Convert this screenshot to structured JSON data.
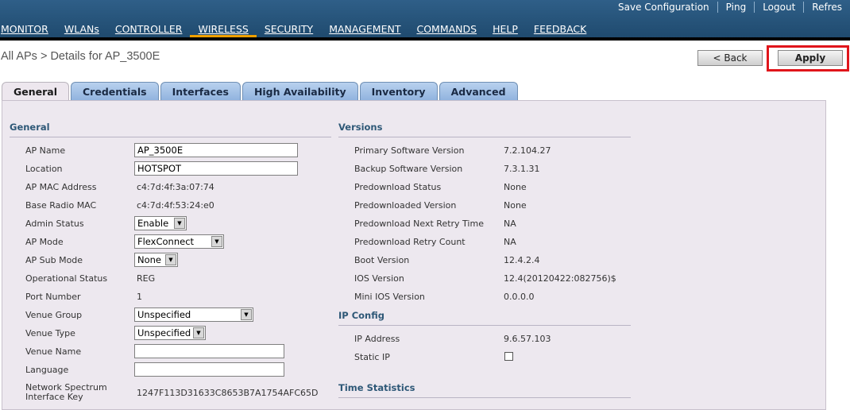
{
  "toplinks": [
    "Save Configuration",
    "Ping",
    "Logout",
    "Refres"
  ],
  "nav": [
    "MONITOR",
    "WLANs",
    "CONTROLLER",
    "WIRELESS",
    "SECURITY",
    "MANAGEMENT",
    "COMMANDS",
    "HELP",
    "FEEDBACK"
  ],
  "active_nav": "WIRELESS",
  "breadcrumb": "All APs > Details for AP_3500E",
  "buttons": {
    "back": "< Back",
    "apply": "Apply"
  },
  "tabs": [
    "General",
    "Credentials",
    "Interfaces",
    "High Availability",
    "Inventory",
    "Advanced"
  ],
  "active_tab": "General",
  "general": {
    "heading": "General",
    "ap_name_label": "AP Name",
    "ap_name_value": "AP_3500E",
    "location_label": "Location",
    "location_value": "HOTSPOT",
    "ap_mac_label": "AP MAC Address",
    "ap_mac_value": "c4:7d:4f:3a:07:74",
    "base_radio_label": "Base Radio MAC",
    "base_radio_value": "c4:7d:4f:53:24:e0",
    "admin_status_label": "Admin Status",
    "admin_status_value": "Enable",
    "ap_mode_label": "AP Mode",
    "ap_mode_value": "FlexConnect",
    "ap_sub_mode_label": "AP Sub Mode",
    "ap_sub_mode_value": "None",
    "op_status_label": "Operational Status",
    "op_status_value": "REG",
    "port_label": "Port Number",
    "port_value": "1",
    "venue_group_label": "Venue Group",
    "venue_group_value": "Unspecified",
    "venue_type_label": "Venue Type",
    "venue_type_value": "Unspecified",
    "venue_name_label": "Venue Name",
    "venue_name_value": "",
    "language_label": "Language",
    "language_value": "",
    "nsi_label_1": "Network Spectrum",
    "nsi_label_2": "Interface Key",
    "nsi_value": "1247F113D31633C8653B7A1754AFC65D"
  },
  "versions": {
    "heading": "Versions",
    "primary_label": "Primary Software Version",
    "primary_value": "7.2.104.27",
    "backup_label": "Backup Software Version",
    "backup_value": "7.3.1.31",
    "predl_status_label": "Predownload Status",
    "predl_status_value": "None",
    "predl_version_label": "Predownloaded Version",
    "predl_version_value": "None",
    "predl_retry_time_label": "Predownload Next Retry Time",
    "predl_retry_time_value": "NA",
    "predl_retry_count_label": "Predownload Retry Count",
    "predl_retry_count_value": "NA",
    "boot_label": "Boot Version",
    "boot_value": "12.4.2.4",
    "ios_label": "IOS Version",
    "ios_value": "12.4(20120422:082756)$",
    "mini_ios_label": "Mini IOS Version",
    "mini_ios_value": "0.0.0.0"
  },
  "ip_config": {
    "heading": "IP Config",
    "ip_label": "IP Address",
    "ip_value": "9.6.57.103",
    "static_label": "Static IP"
  },
  "time_stats": {
    "heading": "Time Statistics"
  }
}
